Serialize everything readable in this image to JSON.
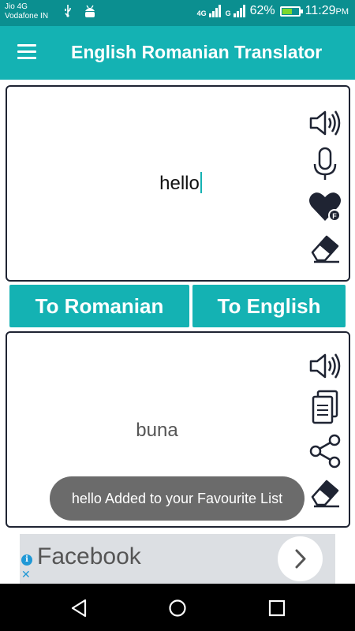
{
  "status_bar": {
    "carrier_1": "Jio 4G",
    "carrier_2": "Vodafone IN",
    "network_1": "4G",
    "network_2": "G",
    "battery_level": "62%",
    "battery_fraction": 0.62,
    "time": "11:29",
    "time_suffix": "PM"
  },
  "app_bar": {
    "title": "English Romanian Translator",
    "menu_icon": "hamburger-menu-icon"
  },
  "input_panel": {
    "text": "hello",
    "icons": [
      "speaker-icon",
      "microphone-icon",
      "favourite-heart-icon",
      "eraser-icon"
    ]
  },
  "buttons": {
    "to_romanian": "To Romanian",
    "to_english": "To English"
  },
  "output_panel": {
    "text": "buna",
    "icons": [
      "speaker-icon",
      "copy-icon",
      "share-icon",
      "eraser-icon"
    ]
  },
  "toast": {
    "message": "hello Added to your Favourite List"
  },
  "ad_banner": {
    "text": "Facebook",
    "info_label": "i",
    "close_label": "✕"
  },
  "colors": {
    "status_bar": "#0b8f90",
    "accent": "#14b2b3",
    "icon_dark": "#1f2433",
    "toast_bg": "#6b6b6b",
    "ad_bg": "#dcdfe3"
  }
}
